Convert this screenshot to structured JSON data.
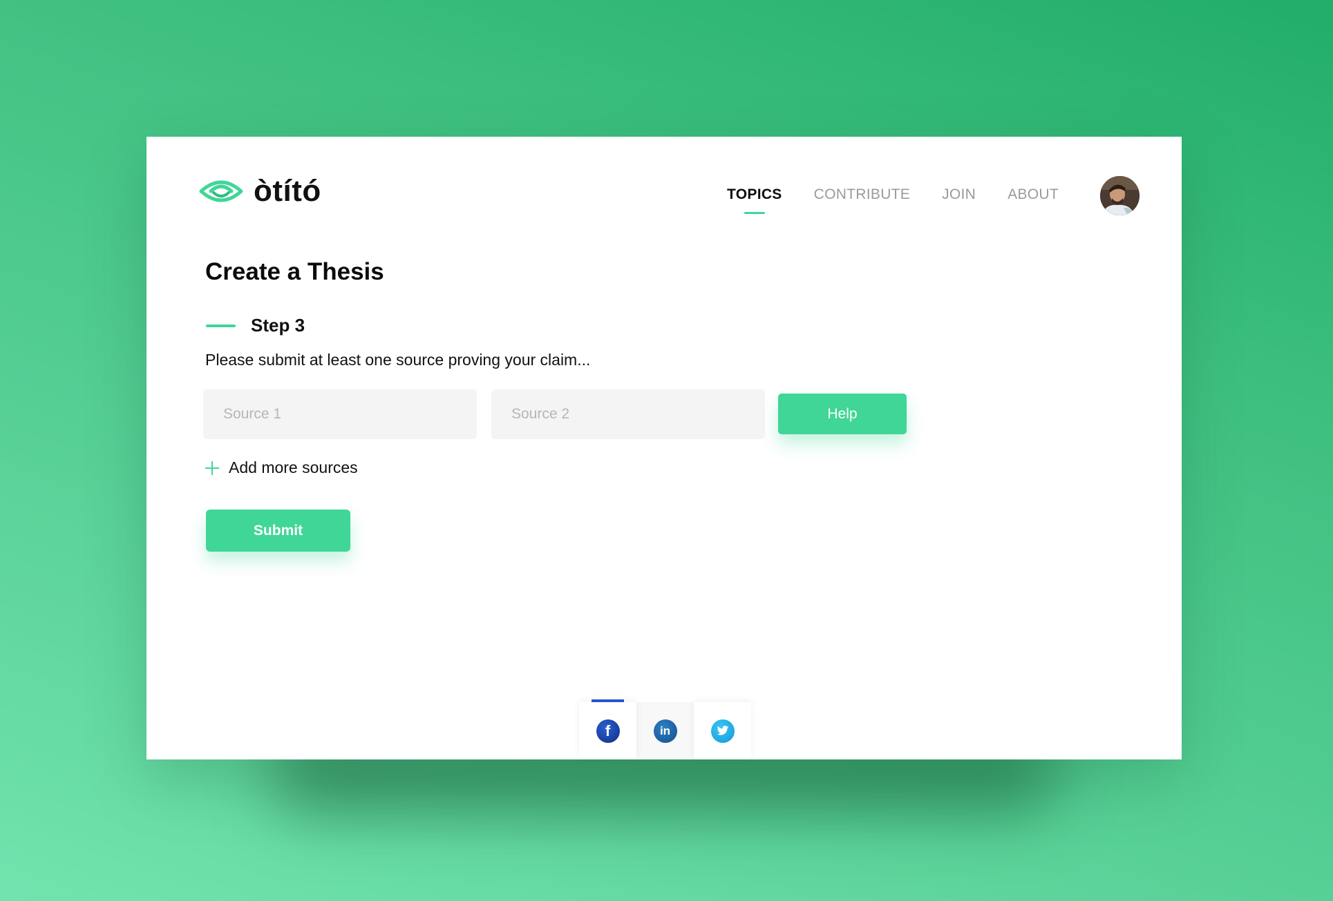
{
  "brand": {
    "name": "òtító",
    "accent": "#40d697"
  },
  "nav": {
    "items": [
      {
        "label": "TOPICS",
        "active": true
      },
      {
        "label": "CONTRIBUTE",
        "active": false
      },
      {
        "label": "JOIN",
        "active": false
      },
      {
        "label": "ABOUT",
        "active": false
      }
    ]
  },
  "main": {
    "title": "Create a Thesis",
    "step_label": "Step 3",
    "instruction": "Please submit at least one source proving your claim...",
    "sources": [
      {
        "placeholder": "Source 1",
        "value": ""
      },
      {
        "placeholder": "Source 2",
        "value": ""
      }
    ],
    "help_label": "Help",
    "add_more_label": "Add more sources",
    "submit_label": "Submit"
  },
  "social": {
    "items": [
      {
        "icon": "facebook-icon",
        "glyph": "f",
        "color": "#1a43a8",
        "active": true
      },
      {
        "icon": "linkedin-icon",
        "glyph": "in",
        "color": "#1d64a8",
        "active": false
      },
      {
        "icon": "twitter-icon",
        "glyph": "",
        "color": "#1eb1ec",
        "active": false
      }
    ]
  }
}
